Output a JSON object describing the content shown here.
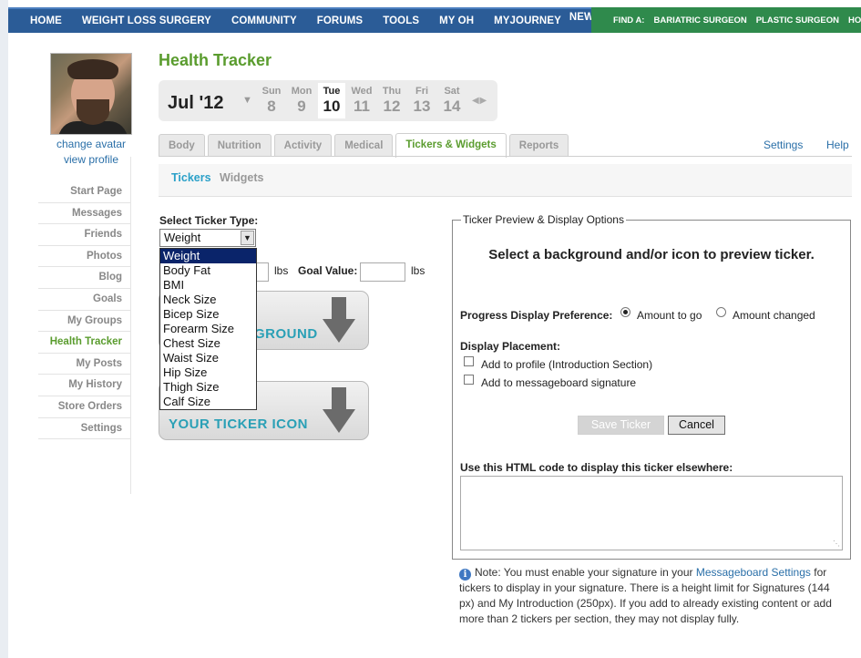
{
  "topnav": {
    "items": [
      "HOME",
      "WEIGHT LOSS SURGERY",
      "COMMUNITY",
      "FORUMS",
      "TOOLS",
      "MY OH",
      "MYJOURNEY"
    ],
    "new_badge": "NEW!",
    "find": [
      "FIND A:",
      "BARIATRIC SURGEON",
      "PLASTIC SURGEON",
      "HOSP"
    ]
  },
  "profile": {
    "change_avatar": "change avatar",
    "view_profile": "view profile"
  },
  "sidebar": {
    "items": [
      {
        "label": "Start Page"
      },
      {
        "label": "Messages"
      },
      {
        "label": "Friends"
      },
      {
        "label": "Photos"
      },
      {
        "label": "Blog"
      },
      {
        "label": "Goals"
      },
      {
        "label": "My Groups"
      },
      {
        "label": "Health Tracker",
        "active": true
      },
      {
        "label": "My Posts"
      },
      {
        "label": "My History"
      },
      {
        "label": "Store Orders"
      },
      {
        "label": "Settings"
      }
    ]
  },
  "page": {
    "title": "Health Tracker"
  },
  "datebar": {
    "month": "Jul '12",
    "days": [
      {
        "name": "Sun",
        "num": "8"
      },
      {
        "name": "Mon",
        "num": "9"
      },
      {
        "name": "Tue",
        "num": "10",
        "current": true
      },
      {
        "name": "Wed",
        "num": "11"
      },
      {
        "name": "Thu",
        "num": "12"
      },
      {
        "name": "Fri",
        "num": "13"
      },
      {
        "name": "Sat",
        "num": "14"
      }
    ]
  },
  "tabs": {
    "items": [
      {
        "label": "Body"
      },
      {
        "label": "Nutrition"
      },
      {
        "label": "Activity"
      },
      {
        "label": "Medical"
      },
      {
        "label": "Tickers & Widgets",
        "active": true
      },
      {
        "label": "Reports"
      }
    ],
    "settings": "Settings",
    "help": "Help"
  },
  "subtabs": {
    "tickers": "Tickers",
    "widgets": "Widgets"
  },
  "ticker": {
    "select_label": "Select Ticker Type:",
    "selected": "Weight",
    "options": [
      "Weight",
      "Body Fat",
      "BMI",
      "Neck Size",
      "Bicep Size",
      "Forearm Size",
      "Chest Size",
      "Waist Size",
      "Hip Size",
      "Thigh Size",
      "Calf Size"
    ],
    "unit1": "lbs",
    "goal_label": "Goal Value:",
    "unit2": "lbs",
    "bg_button_text": "GROUND",
    "icon_button_text": "YOUR TICKER ICON"
  },
  "preview": {
    "legend": "Ticker Preview & Display Options",
    "message": "Select a background and/or icon to preview ticker.",
    "progress_label": "Progress Display Preference:",
    "opt_amount_to_go": "Amount to go",
    "opt_amount_changed": "Amount changed",
    "placement_label": "Display Placement:",
    "add_profile": "Add to profile (Introduction Section)",
    "add_signature": "Add to messageboard signature",
    "save": "Save Ticker",
    "cancel": "Cancel",
    "html_label": "Use this HTML code to display this ticker elsewhere:"
  },
  "note": {
    "before": "Note: You must enable your signature in your ",
    "link": "Messageboard Settings",
    "after": " for tickers to display in your signature. There is a height limit for Signatures (144 px) and My Introduction (250px). If you add to already existing content or add more than 2 tickers per section, they may not display fully."
  }
}
